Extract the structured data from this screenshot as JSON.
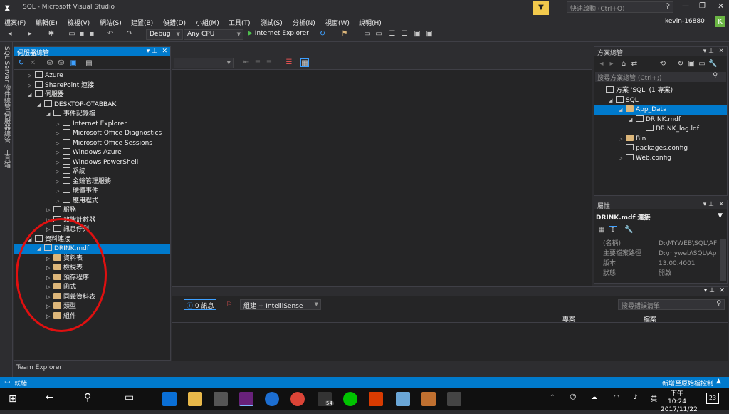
{
  "title": {
    "app": "SQL - Microsoft Visual Studio",
    "quick_launch": "快速啟動 (Ctrl+Q)"
  },
  "menu": [
    "檔案(F)",
    "編輯(E)",
    "檢視(V)",
    "網站(S)",
    "建置(B)",
    "偵錯(D)",
    "小組(M)",
    "工具(T)",
    "測試(S)",
    "分析(N)",
    "視窗(W)",
    "說明(H)"
  ],
  "user": {
    "name": "kevin-16880",
    "avatar_letter": "K"
  },
  "toolbar": {
    "config": "Debug",
    "platform": "Any CPU",
    "run_label": "Internet Explorer"
  },
  "left_tabs": [
    "SQL Server 物件總管",
    "伺服器總管",
    "工具箱"
  ],
  "server_explorer": {
    "title": "伺服器總管",
    "rows": [
      {
        "label": "Azure",
        "depth": 1,
        "toggle": "▷"
      },
      {
        "label": "SharePoint 連接",
        "depth": 1,
        "toggle": "▷"
      },
      {
        "label": "伺服器",
        "depth": 1,
        "toggle": "◢"
      },
      {
        "label": "DESKTOP-OTABBAK",
        "depth": 2,
        "toggle": "◢"
      },
      {
        "label": "事件記錄檔",
        "depth": 3,
        "toggle": "◢"
      },
      {
        "label": "Internet Explorer",
        "depth": 4,
        "toggle": "▷"
      },
      {
        "label": "Microsoft Office Diagnostics",
        "depth": 4,
        "toggle": "▷"
      },
      {
        "label": "Microsoft Office Sessions",
        "depth": 4,
        "toggle": "▷"
      },
      {
        "label": "Windows Azure",
        "depth": 4,
        "toggle": "▷"
      },
      {
        "label": "Windows PowerShell",
        "depth": 4,
        "toggle": "▷"
      },
      {
        "label": "系統",
        "depth": 4,
        "toggle": "▷"
      },
      {
        "label": "金鑰管理服務",
        "depth": 4,
        "toggle": "▷"
      },
      {
        "label": "硬體事件",
        "depth": 4,
        "toggle": "▷"
      },
      {
        "label": "應用程式",
        "depth": 4,
        "toggle": "▷"
      },
      {
        "label": "服務",
        "depth": 3,
        "toggle": "▷"
      },
      {
        "label": "效能計數器",
        "depth": 3,
        "toggle": "▷"
      },
      {
        "label": "訊息佇列",
        "depth": 3,
        "toggle": "▷"
      },
      {
        "label": "資料連接",
        "depth": 1,
        "toggle": "◢"
      },
      {
        "label": "DRINK.mdf",
        "depth": 2,
        "toggle": "◢",
        "selected": true
      },
      {
        "label": "資料表",
        "depth": 3,
        "toggle": "▷",
        "folder": true
      },
      {
        "label": "檢視表",
        "depth": 3,
        "toggle": "▷",
        "folder": true
      },
      {
        "label": "預存程序",
        "depth": 3,
        "toggle": "▷",
        "folder": true
      },
      {
        "label": "函式",
        "depth": 3,
        "toggle": "▷",
        "folder": true
      },
      {
        "label": "同義資料表",
        "depth": 3,
        "toggle": "▷",
        "folder": true
      },
      {
        "label": "類型",
        "depth": 3,
        "toggle": "▷",
        "folder": true
      },
      {
        "label": "組件",
        "depth": 3,
        "toggle": "▷",
        "folder": true
      }
    ]
  },
  "solution_explorer": {
    "title": "方案總管",
    "search_placeholder": "搜尋方案總管 (Ctrl+;)",
    "rows": [
      {
        "label": "方案 'SQL' (1 專案)",
        "depth": 0,
        "toggle": ""
      },
      {
        "label": "SQL",
        "depth": 1,
        "toggle": "◢"
      },
      {
        "label": "App_Data",
        "depth": 2,
        "toggle": "◢",
        "selected": true,
        "folder": true
      },
      {
        "label": "DRINK.mdf",
        "depth": 3,
        "toggle": "◢"
      },
      {
        "label": "DRINK_log.ldf",
        "depth": 4,
        "toggle": ""
      },
      {
        "label": "Bin",
        "depth": 2,
        "toggle": "▷",
        "folder": true
      },
      {
        "label": "packages.config",
        "depth": 2,
        "toggle": ""
      },
      {
        "label": "Web.config",
        "depth": 2,
        "toggle": "▷"
      }
    ]
  },
  "properties": {
    "title": "屬性",
    "object": "DRINK.mdf 連接",
    "rows": [
      {
        "name": "(名稱)",
        "value": "D:\\MYWEB\\SQL\\AF"
      },
      {
        "name": "主要檔案路徑",
        "value": "D:\\myweb\\SQL\\Ap"
      },
      {
        "name": "版本",
        "value": "13.00.4001"
      },
      {
        "name": "狀態",
        "value": "開啟"
      }
    ]
  },
  "error_list": {
    "messages": "0 訊息",
    "build_filter": "組建 + IntelliSense",
    "search_placeholder": "搜尋錯誤清單",
    "col_project": "專案",
    "col_file": "檔案"
  },
  "team_explorer": "Team Explorer",
  "status": {
    "left": "就緒",
    "right": "新增至原始檔控制"
  },
  "taskbar": {
    "time": "下午 10:24",
    "date": "2017/11/22",
    "ime": "英",
    "notify_count": "23",
    "badge": "54"
  }
}
